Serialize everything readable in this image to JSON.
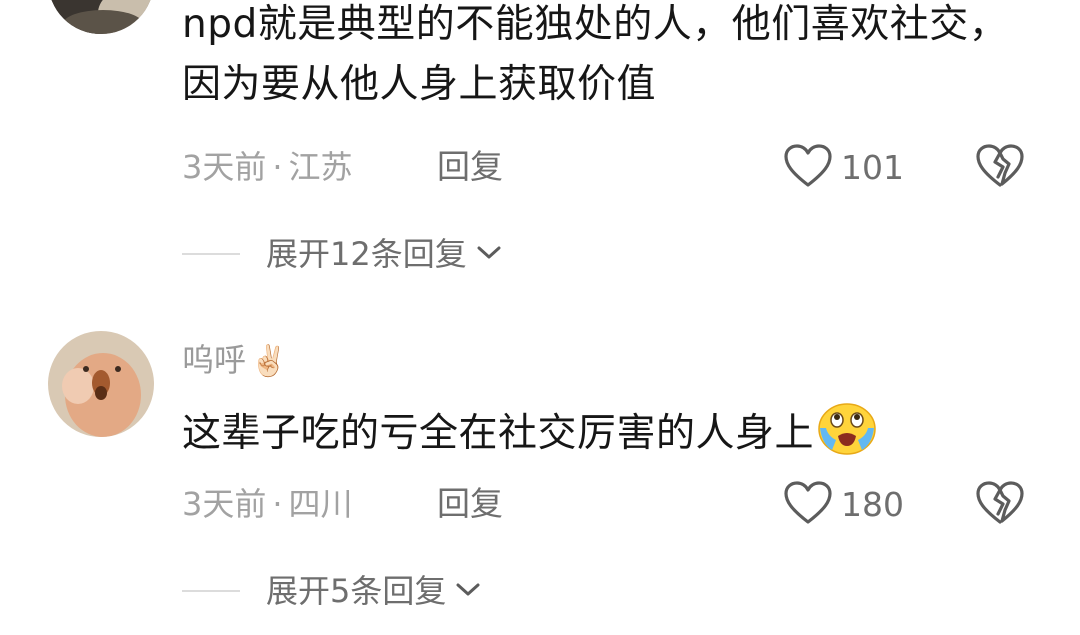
{
  "comments": [
    {
      "username": "",
      "text": "npd就是典型的不能独处的人，他们喜欢社交，因为要从他人身上获取价值",
      "time": "3天前",
      "location": "江苏",
      "reply_label": "回复",
      "likes": "101",
      "expand_label": "展开12条回复"
    },
    {
      "username": "呜呼",
      "username_emoji": "✌🏻",
      "text": "这辈子吃的亏全在社交厉害的人身上",
      "inline_emoji": "😭",
      "time": "3天前",
      "location": "四川",
      "reply_label": "回复",
      "likes": "180",
      "expand_label": "展开5条回复"
    }
  ],
  "separator": "·",
  "icons": {
    "like": "heart-outline-icon",
    "dislike": "broken-heart-icon",
    "expand": "chevron-down-icon"
  }
}
